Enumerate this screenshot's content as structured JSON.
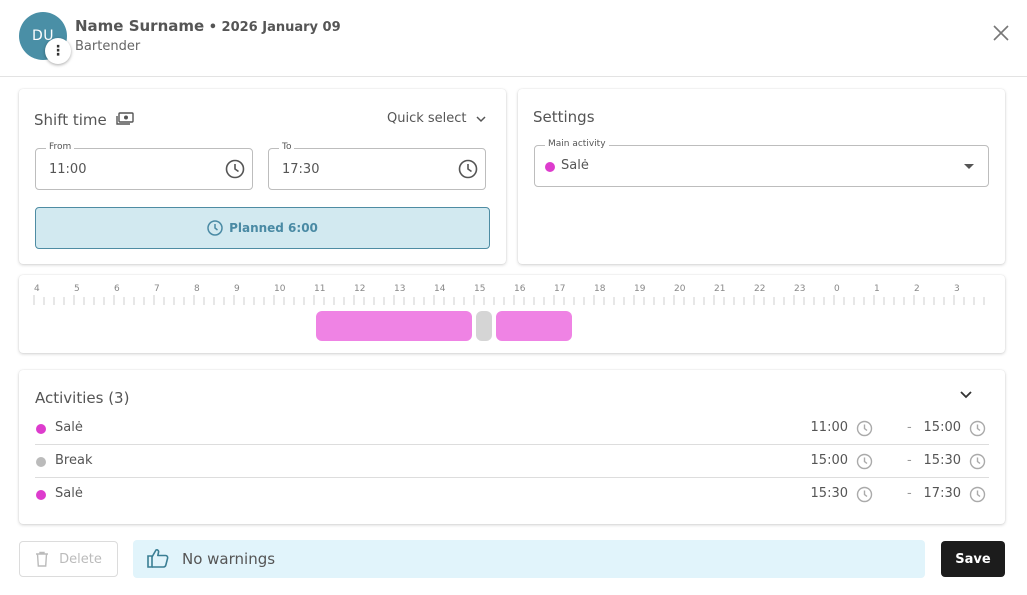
{
  "header": {
    "avatar_initials": "DU",
    "name": "Name Surname",
    "date": " • 2026 January 09",
    "role": "Bartender"
  },
  "shift": {
    "title": "Shift time",
    "quick_select": "Quick select",
    "from_label": "From",
    "from_value": "11:00",
    "to_label": "To",
    "to_value": "17:30",
    "planned_label": "Planned 6:00"
  },
  "settings": {
    "title": "Settings",
    "main_activity_label": "Main activity",
    "main_activity_value": "Salė",
    "main_activity_color": "#dd3ccd"
  },
  "timeline": {
    "hours": [
      "4",
      "5",
      "6",
      "7",
      "8",
      "9",
      "10",
      "11",
      "12",
      "13",
      "14",
      "15",
      "16",
      "17",
      "18",
      "19",
      "20",
      "21",
      "22",
      "23",
      "0",
      "1",
      "2",
      "3"
    ],
    "blocks": [
      {
        "start": "11:00",
        "end": "15:00",
        "color": "#ef83e4"
      },
      {
        "start": "15:00",
        "end": "15:30",
        "color": "#d5d5d5"
      },
      {
        "start": "15:30",
        "end": "17:30",
        "color": "#ef83e4"
      }
    ]
  },
  "activities": {
    "title": "Activities (3)",
    "items": [
      {
        "name": "Salė",
        "start": "11:00",
        "end": "15:00",
        "color": "#dd3ccd"
      },
      {
        "name": "Break",
        "start": "15:00",
        "end": "15:30",
        "color": "#bbbbbb"
      },
      {
        "name": "Salė",
        "start": "15:30",
        "end": "17:30",
        "color": "#dd3ccd"
      }
    ],
    "separator": "-"
  },
  "footer": {
    "delete_label": "Delete",
    "warning_text": "No warnings",
    "save_label": "Save"
  }
}
